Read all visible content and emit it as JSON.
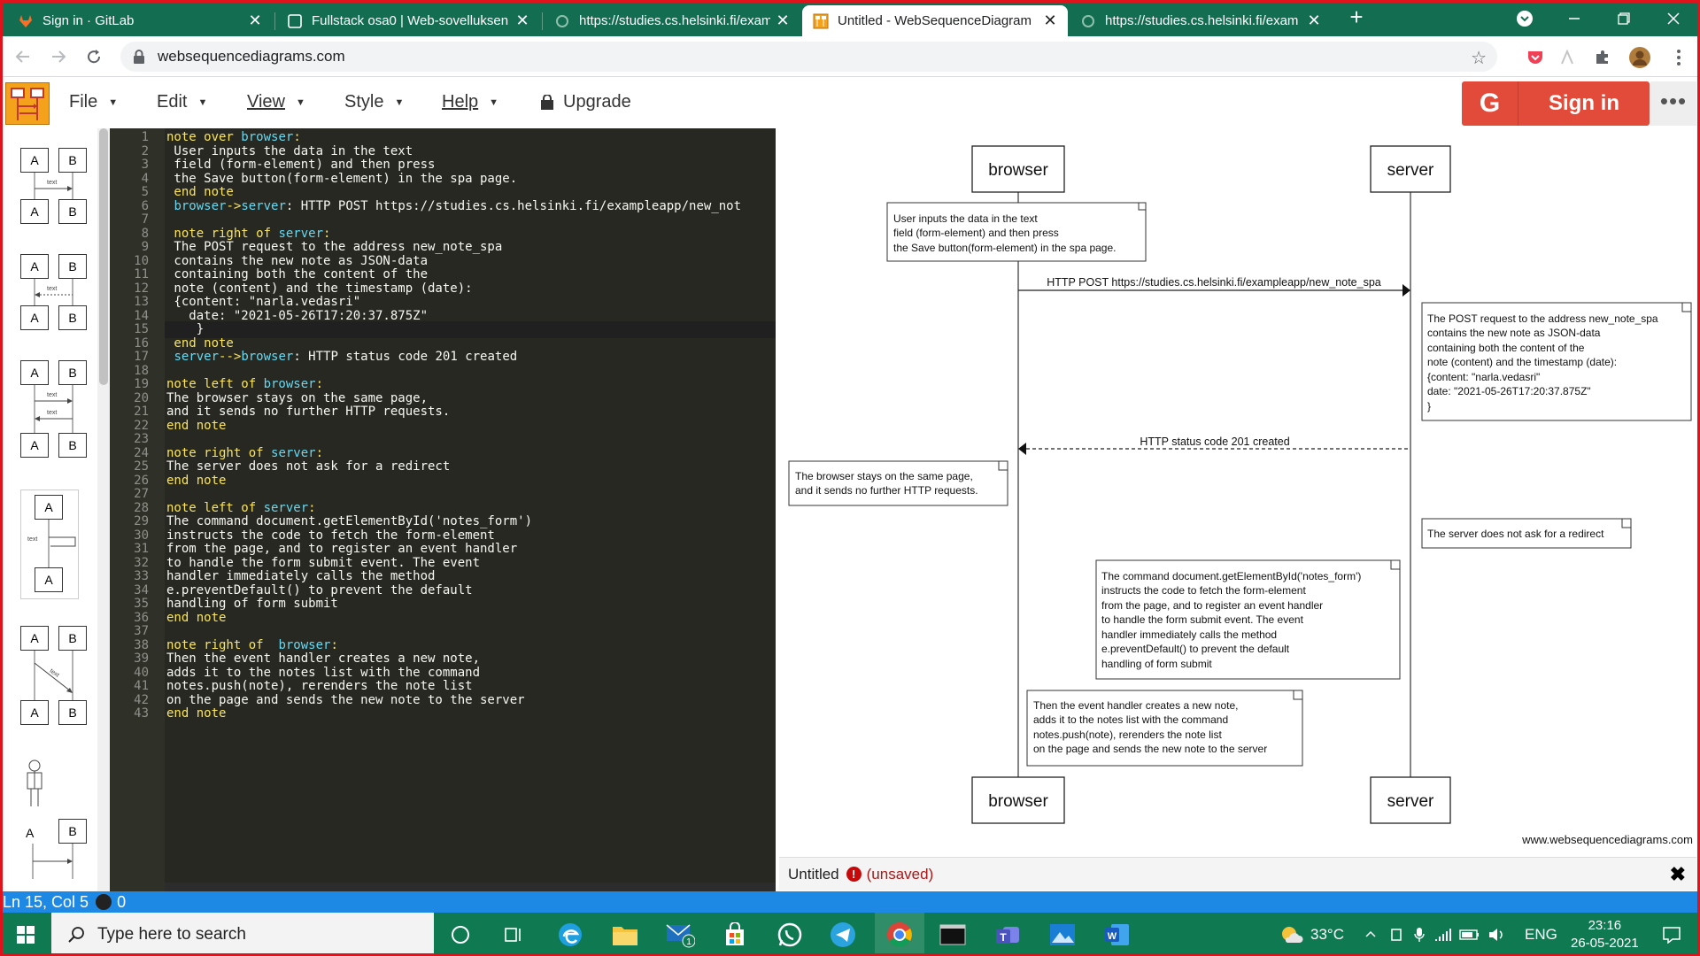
{
  "browser": {
    "tabs": [
      {
        "title": "Sign in · GitLab",
        "icon": "gitlab-icon"
      },
      {
        "title": "Fullstack osa0 | Web-sovelluksen",
        "icon": "page-icon"
      },
      {
        "title": "https://studies.cs.helsinki.fi/exam",
        "icon": "loading-icon"
      },
      {
        "title": "Untitled - WebSequenceDiagram",
        "icon": "wsd-icon"
      },
      {
        "title": "https://studies.cs.helsinki.fi/exam",
        "icon": "loading-icon"
      }
    ],
    "active_tab": 3,
    "url": "websequencediagrams.com"
  },
  "app": {
    "menus": [
      "File",
      "Edit",
      "View",
      "Style",
      "Help"
    ],
    "upgrade_label": "Upgrade",
    "signin_label": "Sign in",
    "signin_g": "G",
    "more_label": "•••"
  },
  "palette": {
    "box_a": "A",
    "box_b": "B",
    "arrow_label": "text"
  },
  "editor": {
    "lines": [
      [
        {
          "t": "note over ",
          "c": "kw"
        },
        {
          "t": "browser",
          "c": "id"
        },
        {
          "t": ":",
          "c": "kw"
        }
      ],
      [
        {
          "t": " User inputs the data in the text",
          "c": ""
        }
      ],
      [
        {
          "t": " field (form-element) and then press",
          "c": ""
        }
      ],
      [
        {
          "t": " the Save button(form-element) in the spa page.",
          "c": ""
        }
      ],
      [
        {
          "t": " end note",
          "c": "kw"
        }
      ],
      [
        {
          "t": " ",
          "c": ""
        },
        {
          "t": "browser",
          "c": "id"
        },
        {
          "t": "->",
          "c": "kw"
        },
        {
          "t": "server",
          "c": "id"
        },
        {
          "t": ": HTTP POST https://studies.cs.helsinki.fi/exampleapp/new_not",
          "c": ""
        }
      ],
      [
        {
          "t": "",
          "c": ""
        }
      ],
      [
        {
          "t": " note right of ",
          "c": "kw"
        },
        {
          "t": "server",
          "c": "id"
        },
        {
          "t": ":",
          "c": "kw"
        }
      ],
      [
        {
          "t": " The POST request to the address new_note_spa",
          "c": ""
        }
      ],
      [
        {
          "t": " contains the new note as JSON-data",
          "c": ""
        }
      ],
      [
        {
          "t": " containing both the content of the",
          "c": ""
        }
      ],
      [
        {
          "t": " note (content) and the timestamp (date):",
          "c": ""
        }
      ],
      [
        {
          "t": " {content: \"narla.vedasri\"",
          "c": ""
        }
      ],
      [
        {
          "t": "   date: \"2021-05-26T17:20:37.875Z\"",
          "c": ""
        }
      ],
      [
        {
          "t": "    }",
          "c": ""
        }
      ],
      [
        {
          "t": " end note",
          "c": "kw"
        }
      ],
      [
        {
          "t": " ",
          "c": ""
        },
        {
          "t": "server",
          "c": "id"
        },
        {
          "t": "-->",
          "c": "kw"
        },
        {
          "t": "browser",
          "c": "id"
        },
        {
          "t": ": HTTP status code 201 created",
          "c": ""
        }
      ],
      [
        {
          "t": "",
          "c": ""
        }
      ],
      [
        {
          "t": "note left of ",
          "c": "kw"
        },
        {
          "t": "browser",
          "c": "id"
        },
        {
          "t": ":",
          "c": "kw"
        }
      ],
      [
        {
          "t": "The browser stays on the same page,",
          "c": ""
        }
      ],
      [
        {
          "t": "and it sends no further HTTP requests.",
          "c": ""
        }
      ],
      [
        {
          "t": "end note",
          "c": "kw"
        }
      ],
      [
        {
          "t": "",
          "c": ""
        }
      ],
      [
        {
          "t": "note right of ",
          "c": "kw"
        },
        {
          "t": "server",
          "c": "id"
        },
        {
          "t": ":",
          "c": "kw"
        }
      ],
      [
        {
          "t": "The server does not ask for a redirect",
          "c": ""
        }
      ],
      [
        {
          "t": "end note",
          "c": "kw"
        }
      ],
      [
        {
          "t": "",
          "c": ""
        }
      ],
      [
        {
          "t": "note left of ",
          "c": "kw"
        },
        {
          "t": "server",
          "c": "id"
        },
        {
          "t": ":",
          "c": "kw"
        }
      ],
      [
        {
          "t": "The command document.getElementById('notes_form')",
          "c": ""
        }
      ],
      [
        {
          "t": "instructs the code to fetch the form-element",
          "c": ""
        }
      ],
      [
        {
          "t": "from the page, and to register an event handler",
          "c": ""
        }
      ],
      [
        {
          "t": "to handle the form submit event. The event",
          "c": ""
        }
      ],
      [
        {
          "t": "handler immediately calls the method",
          "c": ""
        }
      ],
      [
        {
          "t": "e.preventDefault() to prevent the default",
          "c": ""
        }
      ],
      [
        {
          "t": "handling of form submit",
          "c": ""
        }
      ],
      [
        {
          "t": "end note",
          "c": "kw"
        }
      ],
      [
        {
          "t": "",
          "c": ""
        }
      ],
      [
        {
          "t": "note right of  ",
          "c": "kw"
        },
        {
          "t": "browser",
          "c": "id"
        },
        {
          "t": ":",
          "c": "kw"
        }
      ],
      [
        {
          "t": "Then the event handler creates a new note,",
          "c": ""
        }
      ],
      [
        {
          "t": "adds it to the notes list with the command",
          "c": ""
        }
      ],
      [
        {
          "t": "notes.push(note), rerenders the note list",
          "c": ""
        }
      ],
      [
        {
          "t": "on the page and sends the new note to the server",
          "c": ""
        }
      ],
      [
        {
          "t": "end note",
          "c": "kw"
        }
      ]
    ],
    "highlight_line": 15
  },
  "diagram": {
    "participants": [
      "browser",
      "server"
    ],
    "note_over_browser": [
      "User inputs the data in the text",
      "field (form-element) and then press",
      "the Save button(form-element) in the spa page."
    ],
    "post_message": "HTTP POST https://studies.cs.helsinki.fi/exampleapp/new_note_spa",
    "note_post": [
      "The POST request to the address new_note_spa",
      "contains the new note as JSON-data",
      "containing both the content of the",
      "note (content) and the timestamp (date):",
      "{content: \"narla.vedasri\"",
      "date: \"2021-05-26T17:20:37.875Z\"",
      "}"
    ],
    "response_message": "HTTP status code 201 created",
    "note_browser_stays": [
      "The browser stays on the same page,",
      "and it sends no further HTTP requests."
    ],
    "note_redirect": [
      "The server does not ask for a redirect"
    ],
    "note_command": [
      "The command document.getElementById('notes_form')",
      "instructs the code to fetch the form-element",
      "from the page, and to register an event handler",
      "to handle the form submit event. The event",
      "handler immediately calls the method",
      "e.preventDefault() to prevent the default",
      "handling of form submit"
    ],
    "note_handler": [
      "Then the event handler creates a new note,",
      "adds it to the notes list with the command",
      "notes.push(note), rerenders the note list",
      "on the page and sends the new note to the server"
    ],
    "watermark": "www.websequencediagrams.com"
  },
  "document": {
    "name": "Untitled",
    "warn": "!",
    "state": "(unsaved)",
    "close": "✖"
  },
  "status": {
    "cursor": "Ln 15, Col 5",
    "errors": "0"
  },
  "taskbar": {
    "search_placeholder": "Type here to search",
    "temperature": "33°C",
    "language": "ENG",
    "time": "23:16",
    "date": "26-05-2021",
    "mail_badge": "1"
  },
  "colors": {
    "tab_strip": "#136d50",
    "editor_bg": "#272822",
    "keyword": "#f9e45b",
    "identifier": "#67d8ef",
    "signin": "#e24b3a",
    "statusbar": "#1e88e5",
    "taskbar": "#0f7a52"
  }
}
